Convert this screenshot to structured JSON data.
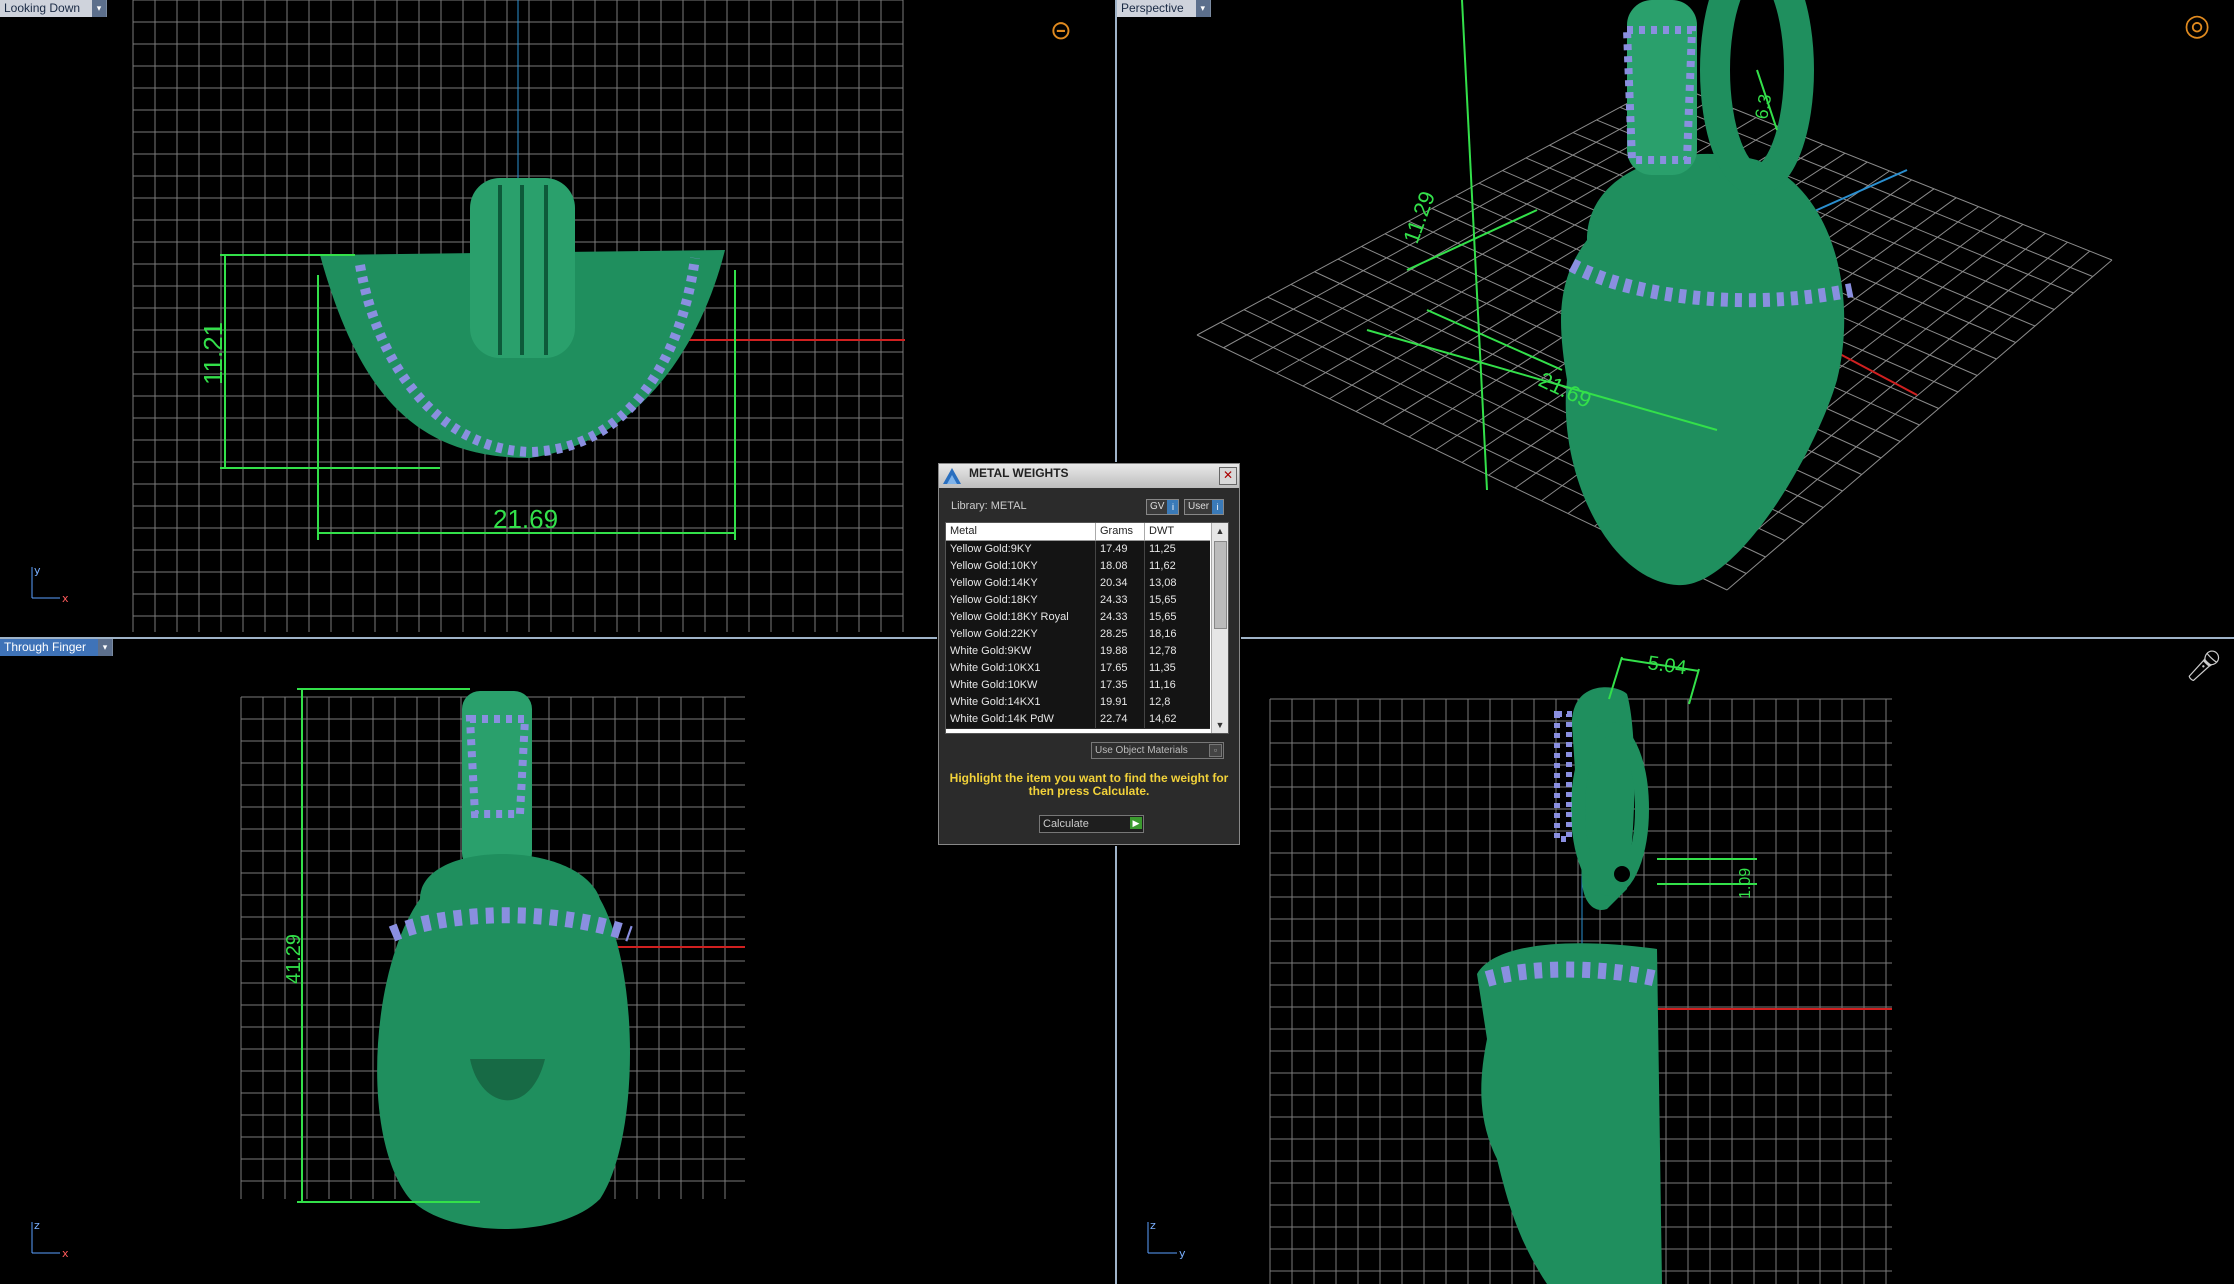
{
  "viewports": {
    "top_left": {
      "label": "Looking Down",
      "axis_a": "y",
      "axis_b": "x",
      "dim_width": "21.69",
      "dim_height": "11.21"
    },
    "top_right": {
      "label": "Perspective",
      "dim_a": "21.69",
      "dim_b": "11.29",
      "dim_c": "6.3"
    },
    "bottom_left": {
      "label": "Through Finger",
      "axis_a": "z",
      "axis_b": "x",
      "dim_height": "41.29"
    },
    "bottom_right": {
      "axis_a": "z",
      "axis_b": "y",
      "dim_top": "5.04",
      "dim_side": "1.09"
    }
  },
  "dialog": {
    "title": "METAL WEIGHTS",
    "library": "Library: METAL",
    "gv_label": "GV",
    "user_label": "User",
    "columns": [
      "Metal",
      "Grams",
      "DWT"
    ],
    "rows": [
      {
        "metal": "Yellow Gold:9KY",
        "grams": "17.49",
        "dwt": "11,25"
      },
      {
        "metal": "Yellow Gold:10KY",
        "grams": "18.08",
        "dwt": "11,62"
      },
      {
        "metal": "Yellow Gold:14KY",
        "grams": "20.34",
        "dwt": "13,08"
      },
      {
        "metal": "Yellow Gold:18KY",
        "grams": "24.33",
        "dwt": "15,65"
      },
      {
        "metal": "Yellow Gold:18KY Royal",
        "grams": "24.33",
        "dwt": "15,65"
      },
      {
        "metal": "Yellow Gold:22KY",
        "grams": "28.25",
        "dwt": "18,16"
      },
      {
        "metal": "White Gold:9KW",
        "grams": "19.88",
        "dwt": "12,78"
      },
      {
        "metal": "White Gold:10KX1",
        "grams": "17.65",
        "dwt": "11,35"
      },
      {
        "metal": "White Gold:10KW",
        "grams": "17.35",
        "dwt": "11,16"
      },
      {
        "metal": "White Gold:14KX1",
        "grams": "19.91",
        "dwt": "12,8"
      },
      {
        "metal": "White Gold:14K PdW",
        "grams": "22.74",
        "dwt": "14,62"
      }
    ],
    "use_object_materials": "Use Object Materials",
    "hint": "Highlight the item you want to find the weight for then press Calculate.",
    "calculate_label": "Calculate"
  },
  "colors": {
    "model": "#1f8f5e",
    "dimension": "#33e04a",
    "grid": "#8a8a8a",
    "stone": "#8a8fe0",
    "hint_text": "#f2d23a"
  }
}
